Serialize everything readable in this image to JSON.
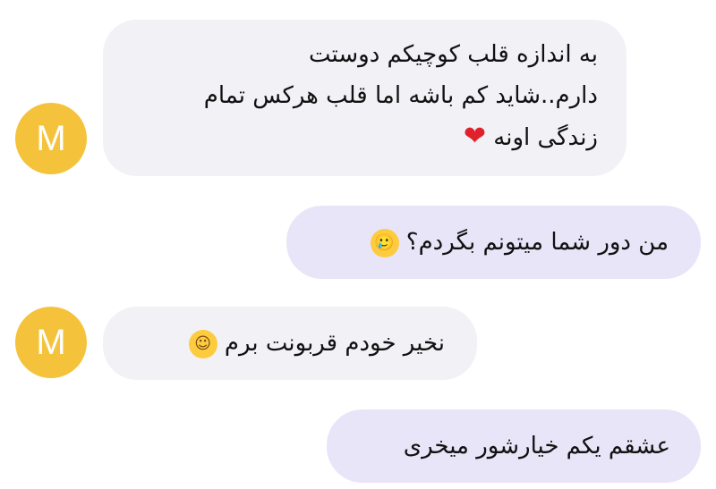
{
  "messages": [
    {
      "sender": "M",
      "direction": "incoming",
      "lines": [
        "به اندازه قلب کوچیکم دوستت",
        "دارم..شاید کم باشه اما قلب هرکس تمام",
        "زندگی اونه"
      ],
      "emoji": "❤"
    },
    {
      "direction": "outgoing",
      "text": "من دور شما میتونم بگردم؟",
      "emoji": "🥲"
    },
    {
      "sender": "M",
      "direction": "incoming",
      "text": "نخیر خودم قربونت برم",
      "emoji": "☺"
    },
    {
      "direction": "outgoing",
      "text": "عشقم یکم خیارشور میخری"
    }
  ],
  "colors": {
    "avatar": "#F5C33B",
    "incoming_bubble": "#F2F1F6",
    "outgoing_bubble": "#E8E5F8"
  }
}
